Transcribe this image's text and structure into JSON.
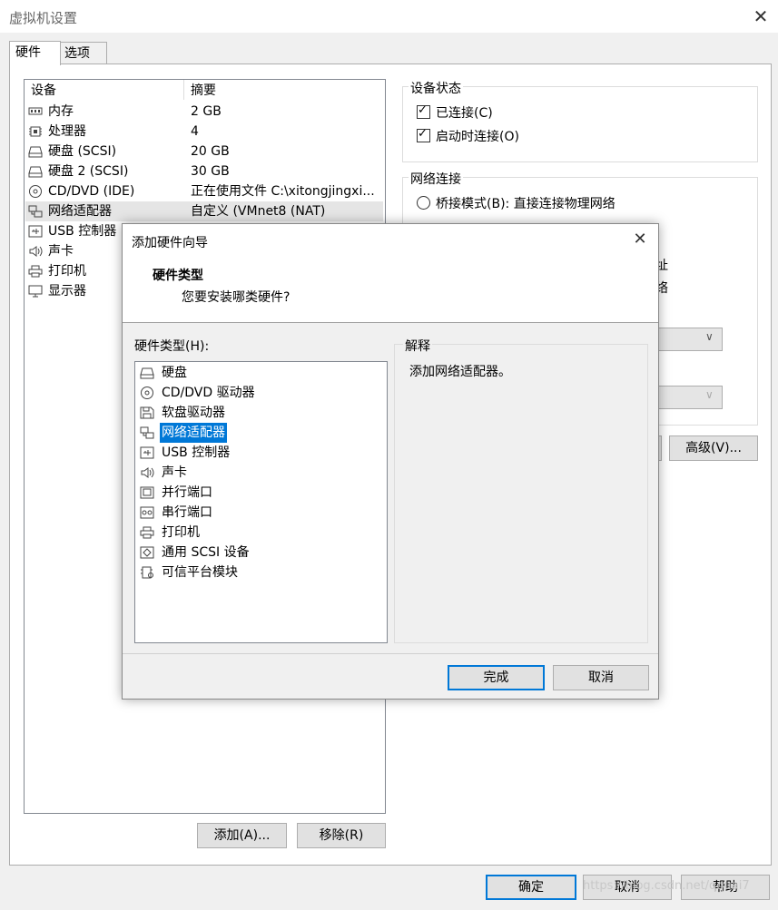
{
  "window": {
    "title": "虚拟机设置",
    "close": "✕"
  },
  "tabs": [
    {
      "label": "硬件"
    },
    {
      "label": "选项"
    }
  ],
  "device_list": {
    "headers": {
      "device": "设备",
      "summary": "摘要"
    },
    "rows": [
      {
        "name": "内存",
        "summary": "2 GB",
        "icon": "memory-icon"
      },
      {
        "name": "处理器",
        "summary": "4",
        "icon": "processor-icon"
      },
      {
        "name": "硬盘 (SCSI)",
        "summary": "20 GB",
        "icon": "hard-disk-icon"
      },
      {
        "name": "硬盘 2 (SCSI)",
        "summary": "30 GB",
        "icon": "hard-disk-icon"
      },
      {
        "name": "CD/DVD (IDE)",
        "summary": "正在使用文件 C:\\xitongjingxi...",
        "icon": "cd-dvd-icon"
      },
      {
        "name": "网络适配器",
        "summary": "自定义 (VMnet8 (NAT)",
        "icon": "network-adapter-icon"
      },
      {
        "name": "USB 控制器",
        "summary": "",
        "icon": "usb-icon"
      },
      {
        "name": "声卡",
        "summary": "",
        "icon": "sound-card-icon"
      },
      {
        "name": "打印机",
        "summary": "",
        "icon": "printer-icon"
      },
      {
        "name": "显示器",
        "summary": "",
        "icon": "display-icon"
      }
    ],
    "add_button": "添加(A)...",
    "remove_button": "移除(R)"
  },
  "device_status": {
    "title": "设备状态",
    "connected": {
      "label": "已连接(C)",
      "checked": true
    },
    "connect_at_power_on": {
      "label": "启动时连接(O)",
      "checked": true
    }
  },
  "network_connection": {
    "title": "网络连接",
    "bridged": {
      "label": "桥接模式(B): 直接连接物理网络",
      "checked": false
    },
    "partial_fragment_1": "址",
    "partial_fragment_2": "络"
  },
  "advanced_button": "高级(V)...",
  "footer": {
    "ok": "确定",
    "cancel": "取消",
    "help": "帮助"
  },
  "watermark": "https://blog.csdn.net/qquai7",
  "dialog": {
    "title": "添加硬件向导",
    "close": "✕",
    "heading": "硬件类型",
    "subheading": "您要安装哪类硬件?",
    "list_label": "硬件类型(H):",
    "items": [
      {
        "label": "硬盘",
        "icon": "hard-disk-icon"
      },
      {
        "label": "CD/DVD 驱动器",
        "icon": "cd-dvd-icon"
      },
      {
        "label": "软盘驱动器",
        "icon": "floppy-icon"
      },
      {
        "label": "网络适配器",
        "icon": "network-adapter-icon",
        "selected": true
      },
      {
        "label": "USB 控制器",
        "icon": "usb-icon"
      },
      {
        "label": "声卡",
        "icon": "sound-card-icon"
      },
      {
        "label": "并行端口",
        "icon": "parallel-port-icon"
      },
      {
        "label": "串行端口",
        "icon": "serial-port-icon"
      },
      {
        "label": "打印机",
        "icon": "printer-icon"
      },
      {
        "label": "通用 SCSI 设备",
        "icon": "scsi-device-icon"
      },
      {
        "label": "可信平台模块",
        "icon": "tpm-icon"
      }
    ],
    "explanation_title": "解释",
    "explanation_text": "添加网络适配器。",
    "finish_button": "完成",
    "cancel_button": "取消"
  }
}
